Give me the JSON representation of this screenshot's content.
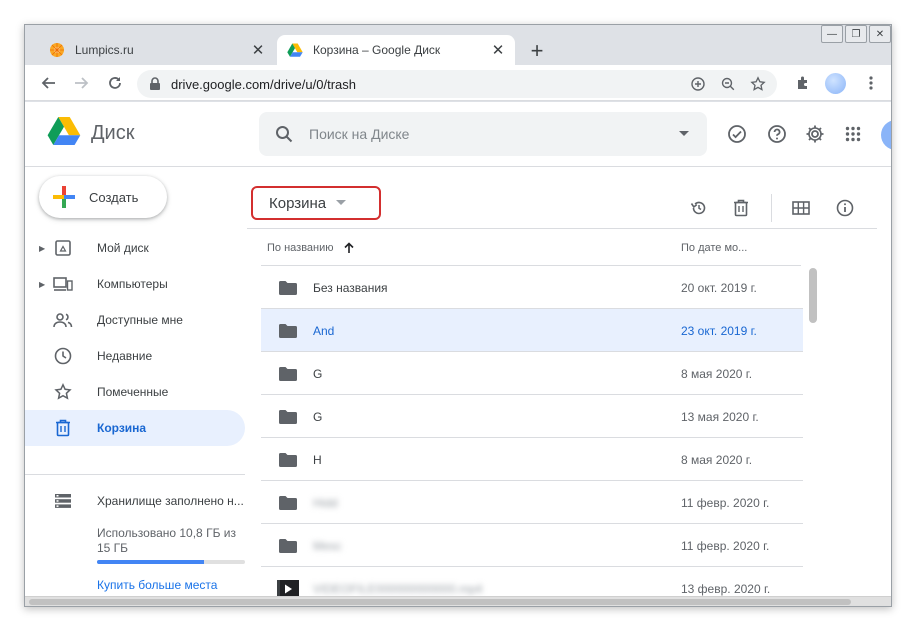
{
  "browser": {
    "tabs": [
      {
        "title": "Lumpics.ru",
        "favicon": "lumpics-favicon",
        "active": false
      },
      {
        "title": "Корзина – Google Диск",
        "favicon": "google-drive-favicon",
        "active": true
      }
    ],
    "new_tab_symbol": "+",
    "url": "drive.google.com/drive/u/0/trash",
    "window_controls": [
      "minimize",
      "restore",
      "close"
    ]
  },
  "drive": {
    "brand": "Диск",
    "search_placeholder": "Поиск на Диске",
    "create_label": "Создать",
    "nav": [
      {
        "label": "Мой диск",
        "icon": "my-drive-icon",
        "expandable": true,
        "active": false
      },
      {
        "label": "Компьютеры",
        "icon": "computers-icon",
        "expandable": true,
        "active": false
      },
      {
        "label": "Доступные мне",
        "icon": "shared-icon",
        "expandable": false,
        "active": false
      },
      {
        "label": "Недавние",
        "icon": "recent-icon",
        "expandable": false,
        "active": false
      },
      {
        "label": "Помеченные",
        "icon": "star-icon",
        "expandable": false,
        "active": false
      },
      {
        "label": "Корзина",
        "icon": "trash-icon",
        "expandable": false,
        "active": true
      }
    ],
    "storage": {
      "title": "Хранилище заполнено н...",
      "used_text": "Использовано 10,8 ГБ из 15 ГБ",
      "used_fraction": 0.72,
      "buy_label": "Купить больше места"
    },
    "breadcrumb": "Корзина",
    "columns": {
      "name": "По названию",
      "date": "По дате мо..."
    },
    "files": [
      {
        "name": "Без названия",
        "date": "20 окт. 2019 г.",
        "type": "folder",
        "blurred": false,
        "selected": false
      },
      {
        "name": "And",
        "date": "23 окт. 2019 г.",
        "type": "folder",
        "blurred": false,
        "selected": true
      },
      {
        "name": "G",
        "date": "8 мая 2020 г.",
        "type": "folder",
        "blurred": false,
        "selected": false
      },
      {
        "name": "G",
        "date": "13 мая 2020 г.",
        "type": "folder",
        "blurred": false,
        "selected": false
      },
      {
        "name": "H",
        "date": "8 мая 2020 г.",
        "type": "folder",
        "blurred": false,
        "selected": false
      },
      {
        "name": "Hidd",
        "date": "11 февр. 2020 г.",
        "type": "folder",
        "blurred": true,
        "selected": false
      },
      {
        "name": "Mesc",
        "date": "11 февр. 2020 г.",
        "type": "folder",
        "blurred": true,
        "selected": false
      },
      {
        "name": "VIDEOFILE000000000000.mp4",
        "date": "13 февр. 2020 г.",
        "type": "video",
        "blurred": true,
        "selected": false
      }
    ]
  },
  "colors": {
    "accent_blue": "#1a73e8",
    "selected_bg": "#e8f0fe",
    "highlight_red": "#d32f2f",
    "folder_gray": "#5f6368"
  }
}
